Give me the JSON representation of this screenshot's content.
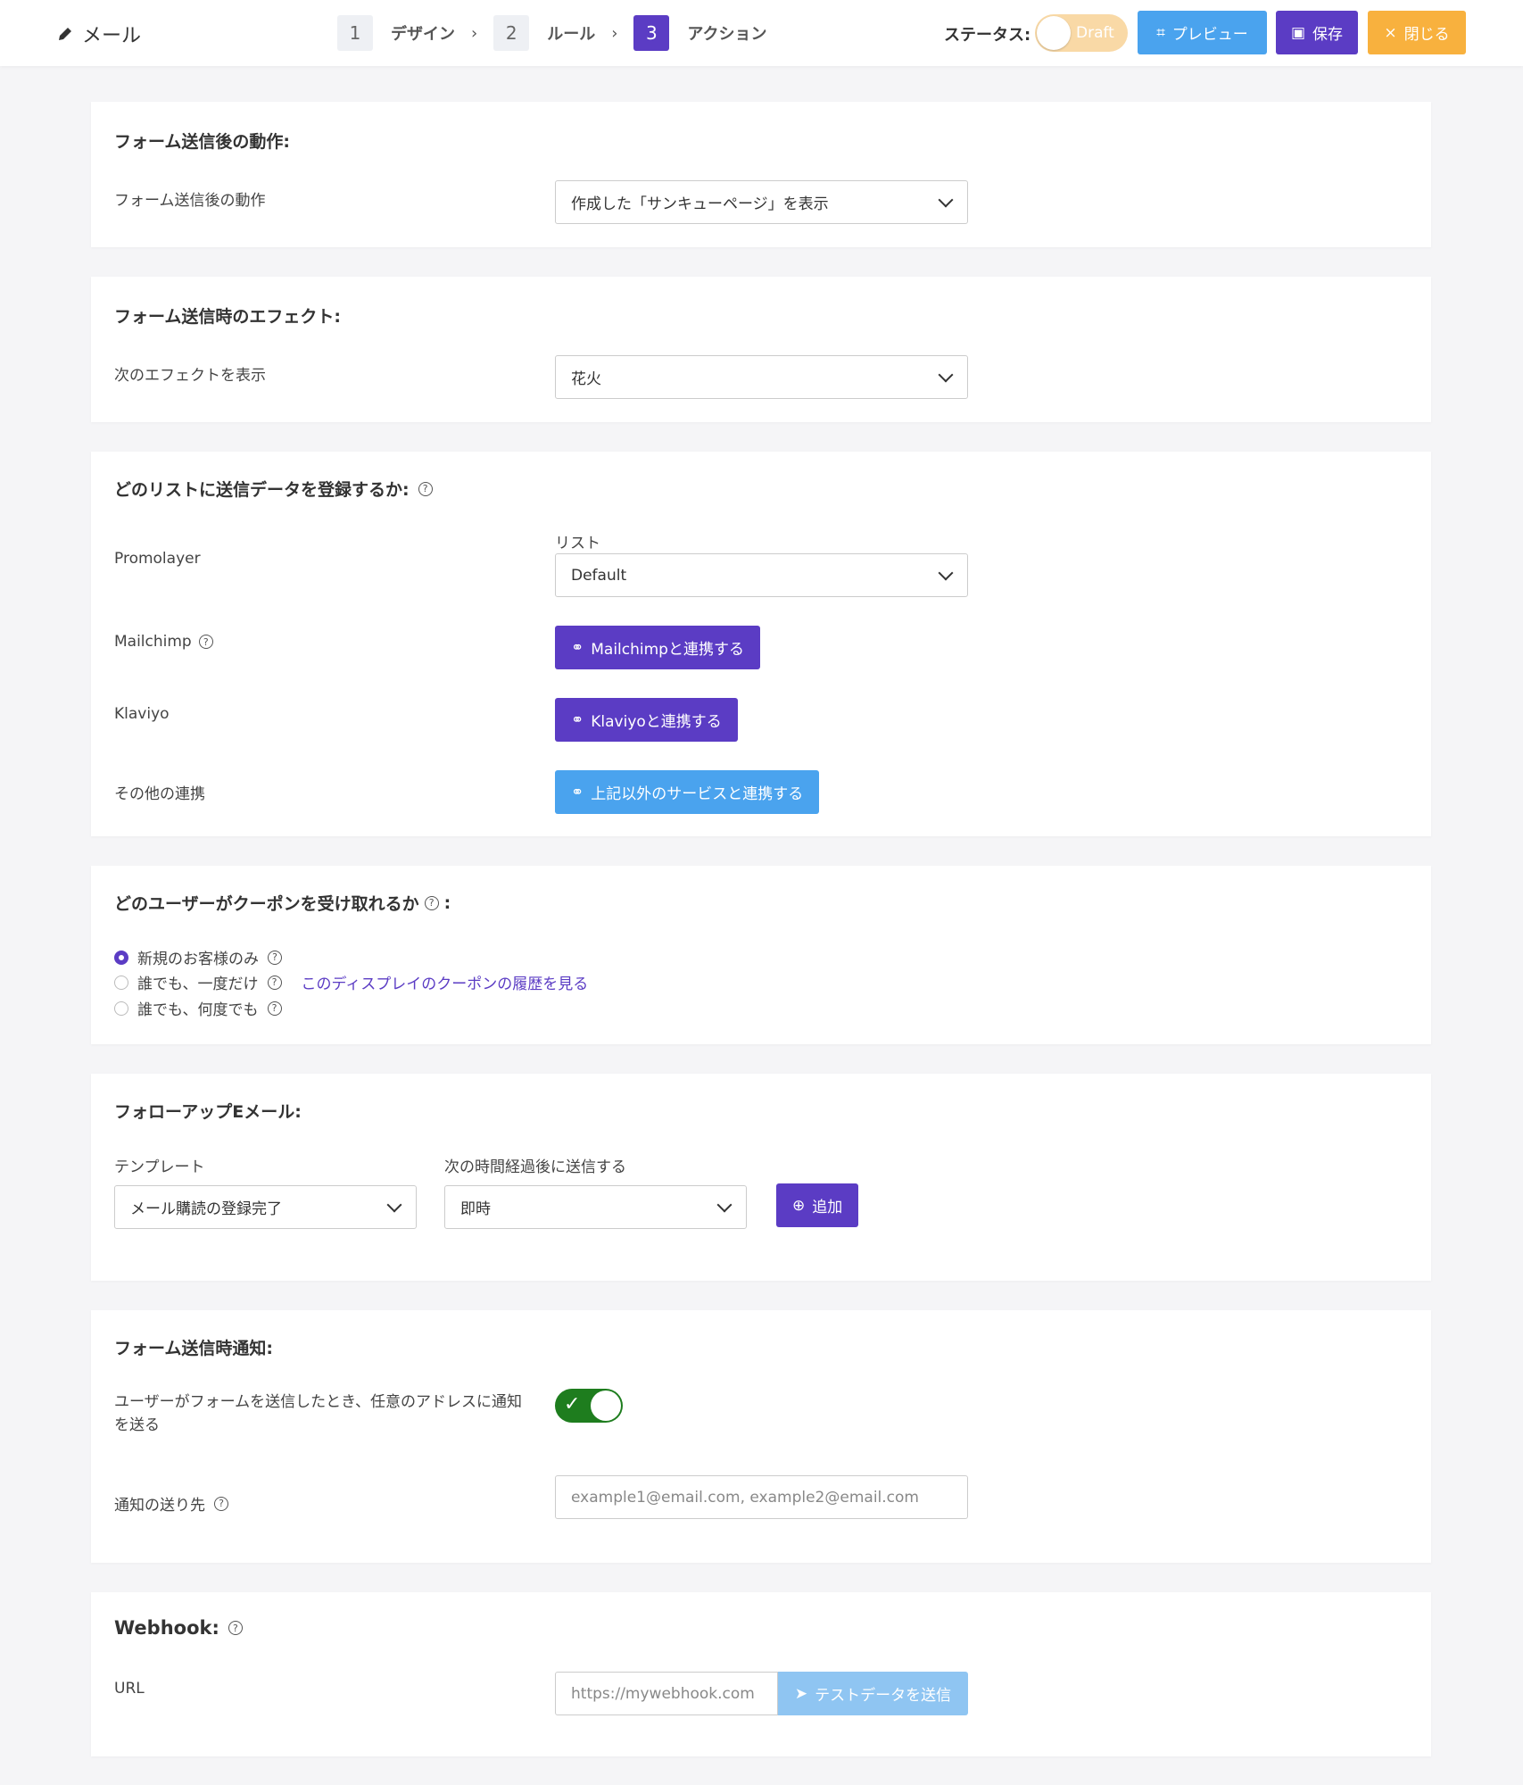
{
  "topbar": {
    "title": "メール",
    "steps": [
      {
        "num": "1",
        "label": "デザイン"
      },
      {
        "num": "2",
        "label": "ルール"
      },
      {
        "num": "3",
        "label": "アクション"
      }
    ],
    "status_label": "ステータス:",
    "status_value": "Draft",
    "preview_label": "プレビュー",
    "save_label": "保存",
    "close_label": "閉じる"
  },
  "after_submit": {
    "title": "フォーム送信後の動作:",
    "label": "フォーム送信後の動作",
    "selected": "作成した「サンキューページ」を表示"
  },
  "effect": {
    "title": "フォーム送信時のエフェクト:",
    "label": "次のエフェクトを表示",
    "selected": "花火"
  },
  "lists": {
    "title": "どのリストに送信データを登録するか:",
    "promolayer_label": "Promolayer",
    "list_label": "リスト",
    "list_selected": "Default",
    "mailchimp_label": "Mailchimp",
    "mailchimp_button": "Mailchimpと連携する",
    "klaviyo_label": "Klaviyo",
    "klaviyo_button": "Klaviyoと連携する",
    "other_label": "その他の連携",
    "other_button": "上記以外のサービスと連携する"
  },
  "coupon": {
    "title": "どのユーザーがクーポンを受け取れるか",
    "title_suffix": ":",
    "options": [
      {
        "label": "新規のお客様のみ",
        "checked": true
      },
      {
        "label": "誰でも、一度だけ",
        "checked": false
      },
      {
        "label": "誰でも、何度でも",
        "checked": false
      }
    ],
    "history_link": "このディスプレイのクーポンの履歴を見る"
  },
  "followup": {
    "title": "フォローアップEメール:",
    "template_label": "テンプレート",
    "template_selected": "メール購読の登録完了",
    "delay_label": "次の時間経過後に送信する",
    "delay_selected": "即時",
    "add_button": "追加"
  },
  "notify": {
    "title": "フォーム送信時通知:",
    "toggle_label": "ユーザーがフォームを送信したとき、任意のアドレスに通知を送る",
    "toggle_on": true,
    "recipient_label": "通知の送り先",
    "recipient_placeholder": "example1@email.com, example2@email.com"
  },
  "webhook": {
    "title": "Webhook:",
    "url_label": "URL",
    "url_placeholder": "https://mywebhook.com",
    "test_button": "テストデータを送信"
  },
  "colors": {
    "primary": "#5b3cc4",
    "blue": "#4aa3ee",
    "orange": "#f8b13e",
    "green": "#1e7d1e"
  }
}
